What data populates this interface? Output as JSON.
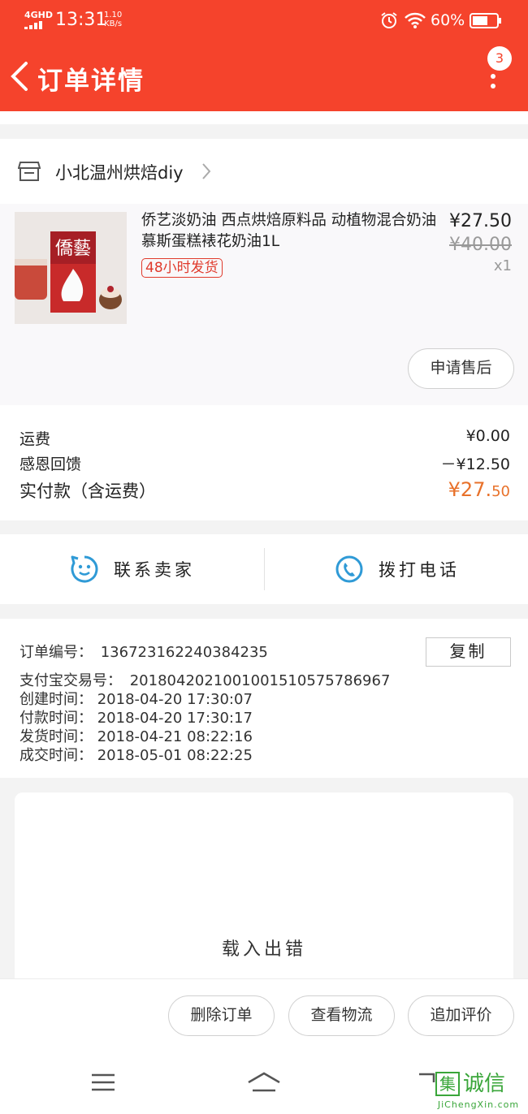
{
  "status_bar": {
    "network": "4GHD",
    "time": "13:31",
    "speed_value": "1.10",
    "speed_unit": "KB/s",
    "battery": "60%"
  },
  "header": {
    "title": "订单详情",
    "badge_count": "3"
  },
  "shop": {
    "name": "小北温州烘焙diy"
  },
  "product": {
    "title": "侨艺淡奶油 西点烘焙原料品 动植物混合奶油慕斯蛋糕裱花奶油1L",
    "tag": "48小时发货",
    "price": "¥27.50",
    "original_price": "¥40.00",
    "quantity": "x1",
    "image_text": "僑藝",
    "aftersale_label": "申请售后"
  },
  "fees": {
    "shipping_label": "运费",
    "shipping_value": "¥0.00",
    "reward_label": "感恩回馈",
    "reward_value": "－¥12.50",
    "total_label": "实付款（含运费）",
    "total_currency": "¥",
    "total_main": "27.",
    "total_cents": "50"
  },
  "contact": {
    "seller_label": "联系卖家",
    "call_label": "拨打电话"
  },
  "order_info": {
    "order_no_label": "订单编号：",
    "order_no": "136723162240384235",
    "copy_label": "复制",
    "alipay_label": "支付宝交易号：",
    "alipay_no": "2018042021001001510575786967",
    "created_label": "创建时间：",
    "created": "2018-04-20 17:30:07",
    "paid_label": "付款时间：",
    "paid": "2018-04-20 17:30:17",
    "shipped_label": "发货时间：",
    "shipped": "2018-04-21 08:22:16",
    "completed_label": "成交时间：",
    "completed": "2018-05-01 08:22:25"
  },
  "recommend": {
    "message": "载入出错"
  },
  "actions": {
    "delete_label": "删除订单",
    "logistics_label": "查看物流",
    "review_label": "追加评价"
  },
  "watermark": {
    "logo_char": "集",
    "text": "诚信",
    "url": "JiChengXin.com"
  },
  "colors": {
    "brand": "#f5432c",
    "price_accent": "#e8712a",
    "contact_icon": "#2f9ad6"
  }
}
